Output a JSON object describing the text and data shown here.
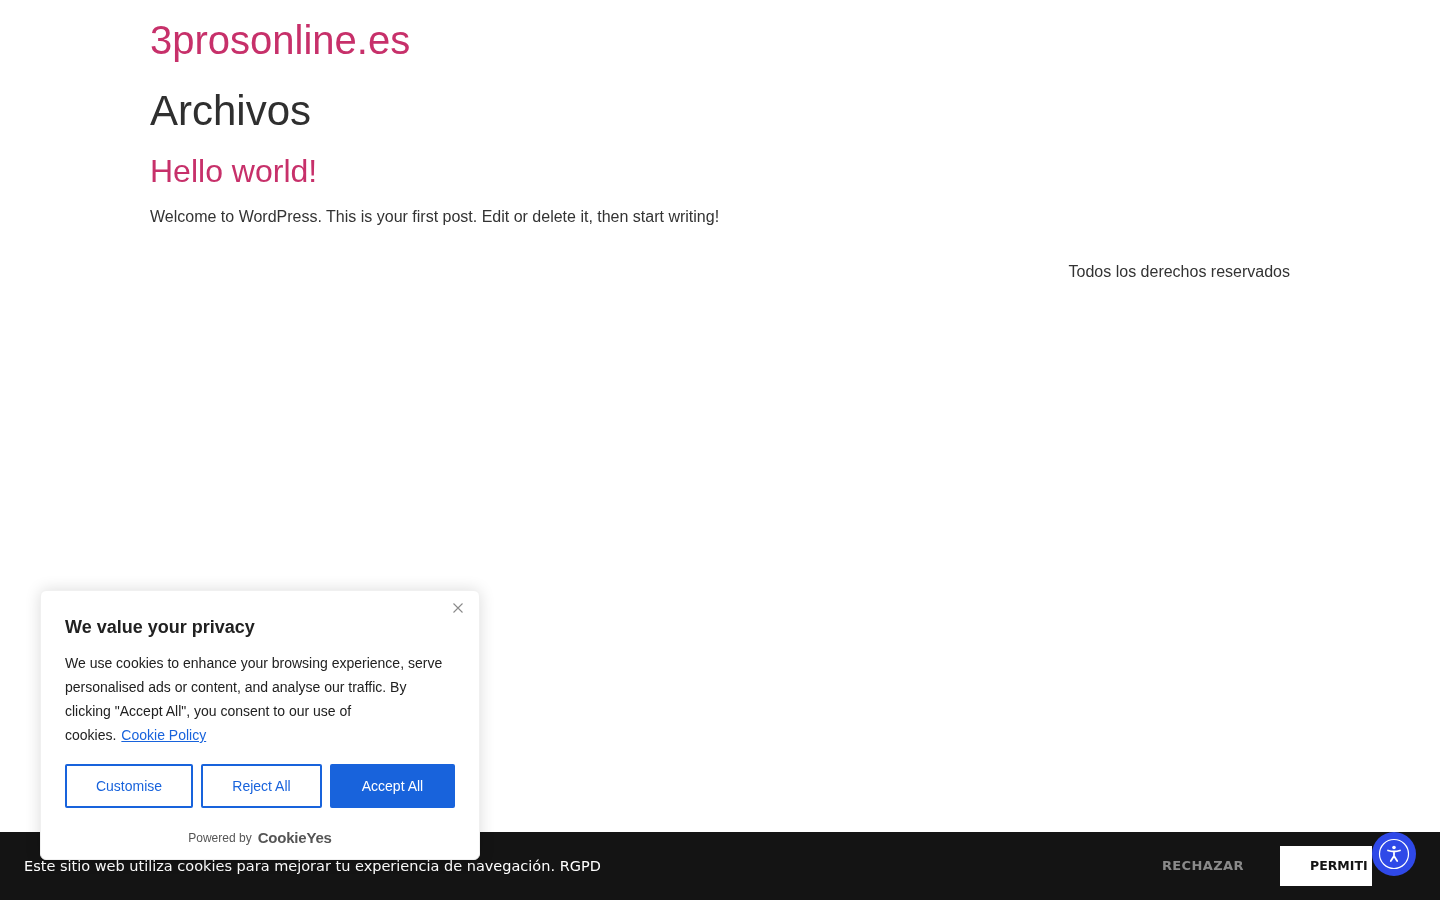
{
  "header": {
    "site_title": "3prosonline.es"
  },
  "archive": {
    "heading": "Archivos",
    "posts": [
      {
        "title": "Hello world!",
        "excerpt": "Welcome to WordPress. This is your first post. Edit or delete it, then start writing!"
      }
    ]
  },
  "footer": {
    "text": "Todos los derechos reservados"
  },
  "cookie_popup": {
    "title": "We value your privacy",
    "body": "We use cookies to enhance your browsing experience, serve personalised ads or content, and analyse our traffic. By clicking \"Accept All\", you consent to our use of cookies.",
    "link": "Cookie Policy",
    "buttons": [
      {
        "label": "Customise",
        "kind": "outline"
      },
      {
        "label": "Reject All",
        "kind": "outline"
      },
      {
        "label": "Accept All",
        "kind": "primary"
      }
    ],
    "powered_by": "Powered by",
    "brand": "CookieYes"
  },
  "cookie_bar": {
    "text": "Este sitio web utiliza cookies para mejorar tu experiencia de navegación. RGPD",
    "buttons": [
      {
        "label": "RECHAZAR",
        "kind": "text"
      },
      {
        "label": "PERMITI",
        "kind": "solid"
      }
    ]
  }
}
